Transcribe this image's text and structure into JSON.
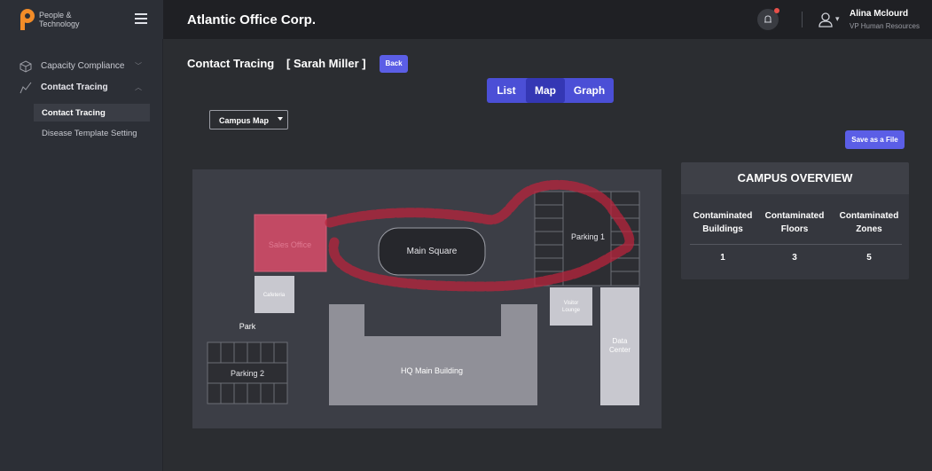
{
  "brand": {
    "line1": "People &",
    "line2": "Technology",
    "accent": "#f28c28"
  },
  "header": {
    "company": "Atlantic Office Corp.",
    "user_name": "Alina Mclourd",
    "user_role": "VP Human Resources"
  },
  "sidebar": {
    "items": [
      {
        "label": "Capacity Compliance",
        "icon": "cube-icon",
        "expanded": false
      },
      {
        "label": "Contact Tracing",
        "icon": "trend-line-icon",
        "expanded": true
      }
    ],
    "sub_items": [
      {
        "label": "Contact Tracing",
        "active": true
      },
      {
        "label": "Disease Template Setting",
        "active": false
      }
    ]
  },
  "page": {
    "title": "Contact Tracing",
    "person": "[ Sarah Miller ]",
    "back_label": "Back",
    "views": [
      "List",
      "Map",
      "Graph"
    ],
    "active_view": "Map",
    "map_select": "Campus Map",
    "save_label": "Save as a File"
  },
  "map": {
    "labels": {
      "sales_office": "Sales Office",
      "main_square": "Main Square",
      "parking1": "Parking 1",
      "cafeteria": "Cafeteria",
      "visitor_lounge_1": "Visitor",
      "visitor_lounge_2": "Lounge",
      "park": "Park",
      "parking2": "Parking 2",
      "hq_main": "HQ Main Building",
      "data_center_1": "Data",
      "data_center_2": "Center"
    },
    "highlight_color": "#c0405a",
    "trace_color": "#b8243c"
  },
  "overview": {
    "title": "CAMPUS OVERVIEW",
    "columns": [
      {
        "label_1": "Contaminated",
        "label_2": "Buildings",
        "value": "1"
      },
      {
        "label_1": "Contaminated",
        "label_2": "Floors",
        "value": "3"
      },
      {
        "label_1": "Contaminated",
        "label_2": "Zones",
        "value": "5"
      }
    ]
  }
}
